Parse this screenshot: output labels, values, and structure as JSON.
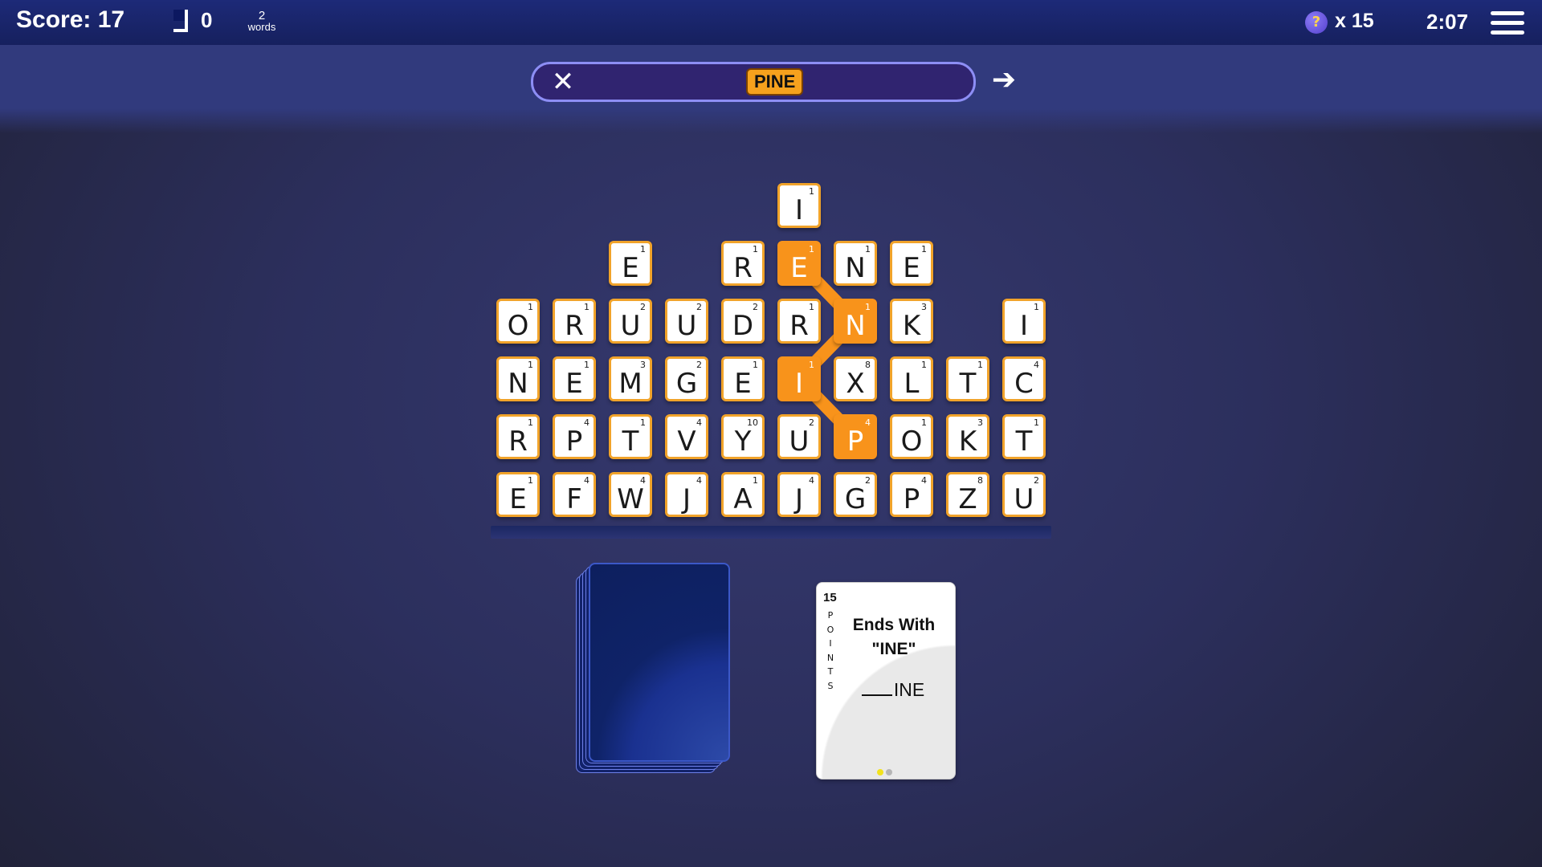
{
  "header": {
    "score_label": "Score: 17",
    "flag_count": "0",
    "words_count": "2",
    "words_label": "words",
    "hint_icon": "hint-orb-icon",
    "hint_count": "x 15",
    "timer": "2:07",
    "menu_icon": "hamburger-menu-icon"
  },
  "word_bar": {
    "clear_icon": "close-icon",
    "current_word": "PINE",
    "submit_icon": "arrow-right-icon"
  },
  "colors": {
    "tile_border": "#f1a32a",
    "tile_selected": "#f8931b",
    "topbar": "#1d2a78",
    "card_back": "#0d1f5e"
  },
  "board": {
    "columns": 10,
    "rows": [
      [
        null,
        null,
        null,
        null,
        null,
        {
          "l": "I",
          "p": "1"
        },
        null,
        null,
        null,
        null
      ],
      [
        null,
        null,
        {
          "l": "E",
          "p": "1"
        },
        null,
        {
          "l": "R",
          "p": "1"
        },
        {
          "l": "E",
          "p": "1",
          "sel": true
        },
        {
          "l": "N",
          "p": "1"
        },
        {
          "l": "E",
          "p": "1"
        },
        null,
        null
      ],
      [
        {
          "l": "O",
          "p": "1"
        },
        {
          "l": "R",
          "p": "1"
        },
        {
          "l": "U",
          "p": "2"
        },
        {
          "l": "U",
          "p": "2"
        },
        {
          "l": "D",
          "p": "2"
        },
        {
          "l": "R",
          "p": "1"
        },
        {
          "l": "N",
          "p": "1",
          "sel": true
        },
        {
          "l": "K",
          "p": "3"
        },
        null,
        {
          "l": "I",
          "p": "1"
        }
      ],
      [
        {
          "l": "N",
          "p": "1"
        },
        {
          "l": "E",
          "p": "1"
        },
        {
          "l": "M",
          "p": "3"
        },
        {
          "l": "G",
          "p": "2"
        },
        {
          "l": "E",
          "p": "1"
        },
        {
          "l": "I",
          "p": "1",
          "sel": true
        },
        {
          "l": "X",
          "p": "8"
        },
        {
          "l": "L",
          "p": "1"
        },
        {
          "l": "T",
          "p": "1"
        },
        {
          "l": "C",
          "p": "4"
        }
      ],
      [
        {
          "l": "R",
          "p": "1"
        },
        {
          "l": "P",
          "p": "4"
        },
        {
          "l": "T",
          "p": "1"
        },
        {
          "l": "V",
          "p": "4"
        },
        {
          "l": "Y",
          "p": "10"
        },
        {
          "l": "U",
          "p": "2"
        },
        {
          "l": "P",
          "p": "4",
          "sel": true
        },
        {
          "l": "O",
          "p": "1"
        },
        {
          "l": "K",
          "p": "3"
        },
        {
          "l": "T",
          "p": "1"
        }
      ],
      [
        {
          "l": "E",
          "p": "1"
        },
        {
          "l": "F",
          "p": "4"
        },
        {
          "l": "W",
          "p": "4"
        },
        {
          "l": "J",
          "p": "4"
        },
        {
          "l": "A",
          "p": "1"
        },
        {
          "l": "J",
          "p": "4"
        },
        {
          "l": "G",
          "p": "2"
        },
        {
          "l": "P",
          "p": "4"
        },
        {
          "l": "Z",
          "p": "8"
        },
        {
          "l": "U",
          "p": "2"
        }
      ]
    ],
    "path_cells": [
      [
        4,
        6
      ],
      [
        3,
        5
      ],
      [
        2,
        6
      ],
      [
        1,
        5
      ]
    ]
  },
  "bonus_card": {
    "points": "15",
    "points_label": [
      "P",
      "O",
      "I",
      "N",
      "T",
      "S"
    ],
    "title_line1": "Ends With",
    "title_line2": "\"INE\"",
    "pattern_suffix": "INE",
    "page_dots": [
      "#f2e21c",
      "#b5b5b5"
    ]
  },
  "deck": {
    "card_count": 5
  }
}
